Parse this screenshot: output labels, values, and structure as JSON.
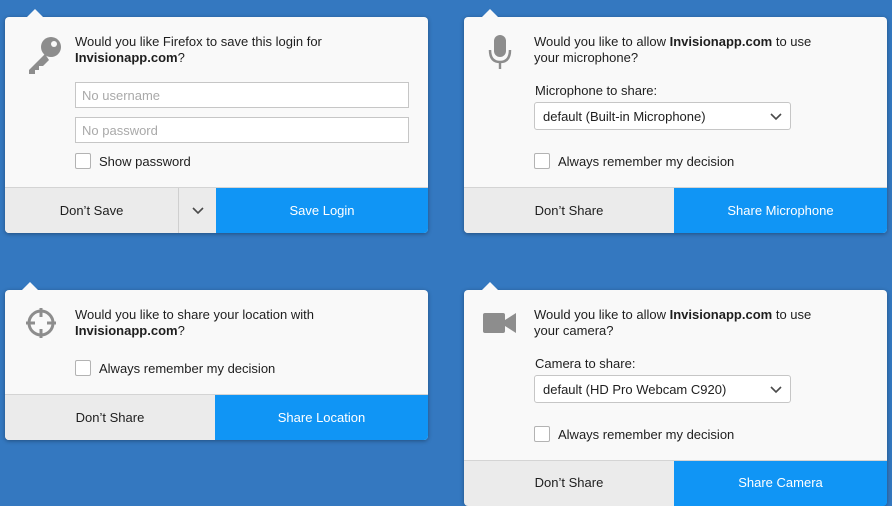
{
  "login": {
    "question_pre": "Would you like Firefox to save this login for",
    "site": "Invisionapp.com",
    "question_post": "?",
    "username_placeholder": "No username",
    "password_placeholder": "No password",
    "show_password_label": "Show password",
    "dont_save_label": "Don’t Save",
    "save_label": "Save Login",
    "icon": "key-icon"
  },
  "microphone": {
    "question_pre": "Would you like to allow",
    "site": "Invisionapp.com",
    "question_post": "to use your microphone?",
    "select_label": "Microphone to share:",
    "selected_value": "default (Built-in Microphone)",
    "remember_label": "Always remember my decision",
    "dont_share_label": "Don’t Share",
    "share_label": "Share Microphone",
    "icon": "microphone-icon"
  },
  "location": {
    "question_pre": "Would you like to share your location with",
    "site": "Invisionapp.com",
    "question_post": "?",
    "remember_label": "Always remember my decision",
    "dont_share_label": "Don’t Share",
    "share_label": "Share Location",
    "icon": "location-crosshair-icon"
  },
  "camera": {
    "question_pre": "Would you like to allow",
    "site": "Invisionapp.com",
    "question_post": "to use your camera?",
    "select_label": "Camera to share:",
    "selected_value": "default (HD Pro Webcam C920)",
    "remember_label": "Always remember my decision",
    "dont_share_label": "Don’t Share",
    "share_label": "Share Camera",
    "icon": "video-camera-icon"
  },
  "colors": {
    "background": "#3478c0",
    "primary_button": "#1095f5",
    "secondary_button": "#ebebeb",
    "panel": "#f9f9f9"
  }
}
